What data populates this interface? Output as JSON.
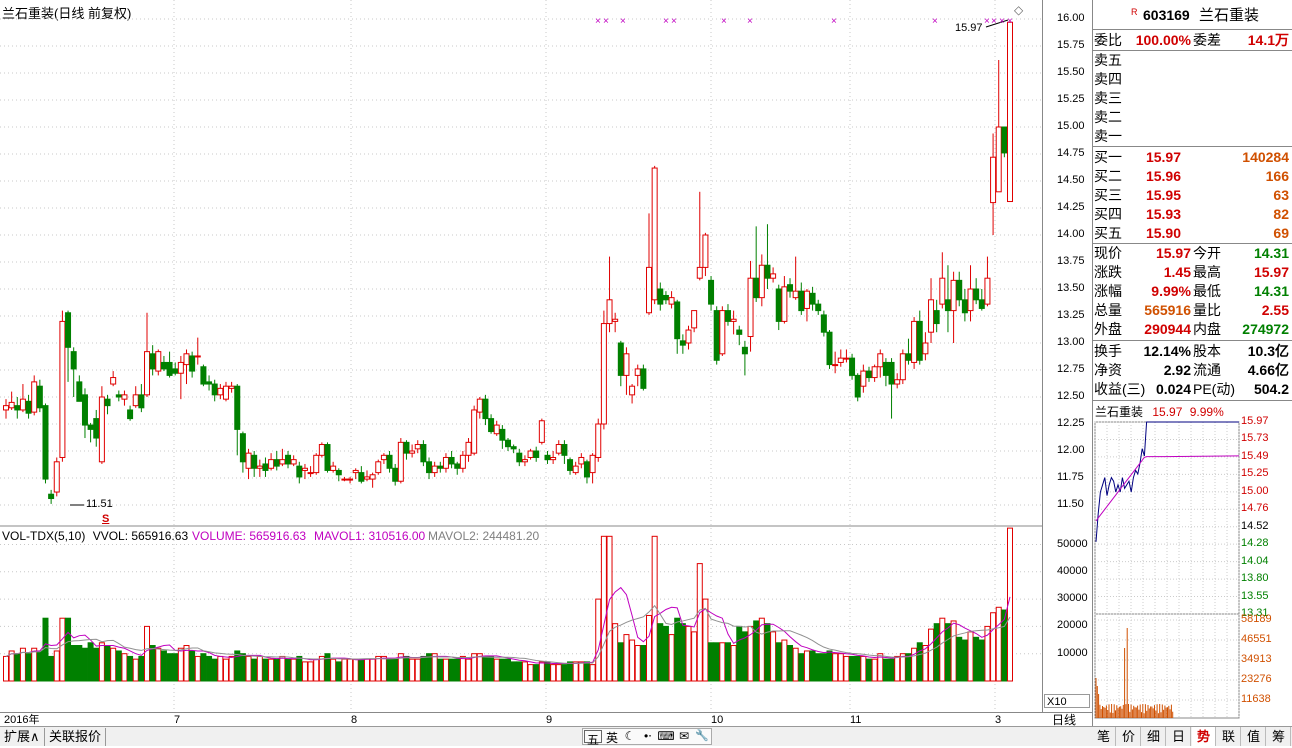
{
  "title": "兰石重装(日线 前复权)",
  "kline": {
    "price_ticks": [
      "16.00",
      "15.75",
      "15.50",
      "15.25",
      "15.00",
      "14.75",
      "14.50",
      "14.25",
      "14.00",
      "13.75",
      "13.50",
      "13.25",
      "13.00",
      "12.75",
      "12.50",
      "12.25",
      "12.00",
      "11.75",
      "11.50"
    ],
    "low_label": "11.51",
    "high_label": "15.97",
    "s_marker": "S",
    "x_markers": [
      "×",
      "×",
      "×",
      "×",
      "×",
      "×",
      "×",
      "×",
      "×",
      "×",
      "×",
      "×",
      "×"
    ],
    "diamond": "◇"
  },
  "volume_panel": {
    "header": "VOL-TDX(5,10)",
    "vvol": "VVOL: 565916.63",
    "volume": "VOLUME: 565916.63",
    "mavol1": "MAVOL1: 310516.00",
    "mavol2": "MAVOL2: 244481.20",
    "ticks": [
      "50000",
      "40000",
      "30000",
      "20000",
      "10000"
    ],
    "scale": "X10"
  },
  "x_axis": {
    "labels": [
      "2016年",
      "7",
      "8",
      "9",
      "10",
      "11",
      "3"
    ],
    "period": "日线"
  },
  "quote": {
    "badge": "R",
    "code": "603169",
    "name": "兰石重装",
    "weibi_label": "委比",
    "weibi": "100.00%",
    "weicha_label": "委差",
    "weicha": "14.1万",
    "sell": [
      {
        "label": "卖五"
      },
      {
        "label": "卖四"
      },
      {
        "label": "卖三"
      },
      {
        "label": "卖二"
      },
      {
        "label": "卖一"
      }
    ],
    "buy": [
      {
        "label": "买一",
        "price": "15.97",
        "vol": "140284"
      },
      {
        "label": "买二",
        "price": "15.96",
        "vol": "166"
      },
      {
        "label": "买三",
        "price": "15.95",
        "vol": "63"
      },
      {
        "label": "买四",
        "price": "15.93",
        "vol": "82"
      },
      {
        "label": "买五",
        "price": "15.90",
        "vol": "69"
      }
    ],
    "stats": [
      {
        "l1": "现价",
        "v1": "15.97",
        "c1": "red",
        "l2": "今开",
        "v2": "14.31",
        "c2": "green"
      },
      {
        "l1": "涨跌",
        "v1": "1.45",
        "c1": "red",
        "l2": "最高",
        "v2": "15.97",
        "c2": "red"
      },
      {
        "l1": "涨幅",
        "v1": "9.99%",
        "c1": "red",
        "l2": "最低",
        "v2": "14.31",
        "c2": "green"
      },
      {
        "l1": "总量",
        "v1": "565916",
        "c1": "orange",
        "l2": "量比",
        "v2": "2.55",
        "c2": "red"
      },
      {
        "l1": "外盘",
        "v1": "290944",
        "c1": "red",
        "l2": "内盘",
        "v2": "274972",
        "c2": "green"
      }
    ],
    "fund": [
      {
        "l1": "换手",
        "v1": "12.14%",
        "l2": "股本",
        "v2": "10.3亿"
      },
      {
        "l1": "净资",
        "v1": "2.92",
        "l2": "流通",
        "v2": "4.66亿"
      },
      {
        "l1": "收益(三)",
        "v1": "0.024",
        "l2": "PE(动)",
        "v2": "504.2"
      }
    ]
  },
  "mini_chart": {
    "name": "兰石重装",
    "price": "15.97",
    "pct": "9.99%",
    "price_ticks": [
      "15.97",
      "15.73",
      "15.49",
      "15.25",
      "15.00",
      "14.76",
      "14.52",
      "14.28",
      "14.04",
      "13.80",
      "13.55",
      "13.31"
    ],
    "vol_ticks": [
      "58189",
      "46551",
      "34913",
      "23276",
      "11638"
    ]
  },
  "bottom": {
    "tabs": [
      "扩展∧",
      "关联报价"
    ],
    "tools": [
      "五",
      "英",
      "☾",
      "•⋅",
      "⌨",
      "✉",
      "🔧"
    ],
    "panel_tabs": [
      "笔",
      "价",
      "细",
      "日",
      "势",
      "联",
      "值",
      "筹"
    ],
    "active_panel_tab": "势"
  },
  "colors": {
    "up": "#e00000",
    "down": "#008000",
    "ma_pink": "#c000c0",
    "grid": "#c8c8c8"
  }
}
